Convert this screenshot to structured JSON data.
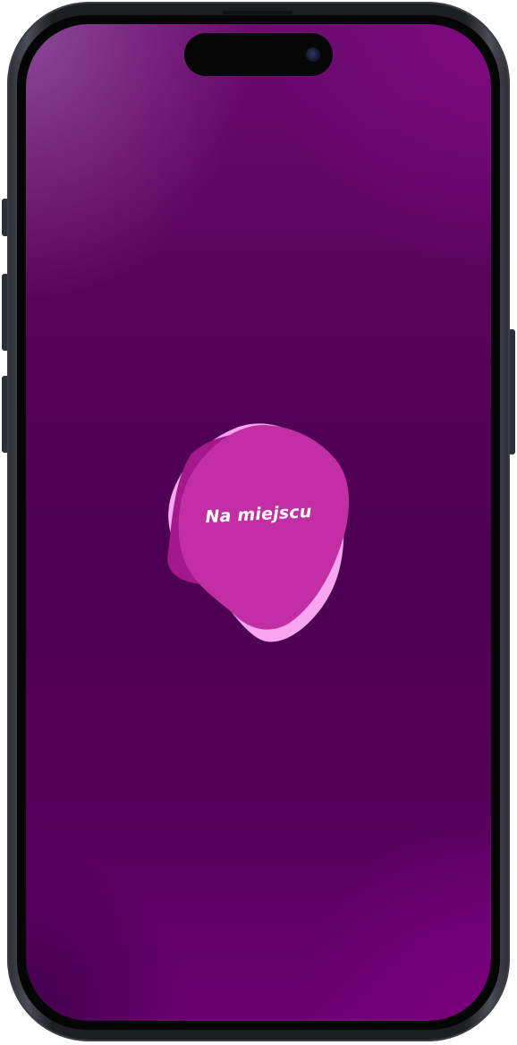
{
  "app": {
    "logo_text": "Na miejscu"
  },
  "theme": {
    "background_primary": "#4d0052",
    "background_accent": "#7b0080",
    "blob_light": "#f7a6ef",
    "blob_main": "#c22ea4",
    "blob_dark": "#a3188a",
    "text": "#ffffff"
  },
  "icons": {
    "camera": "camera-lens-icon",
    "logo": "blob-logo-icon"
  }
}
